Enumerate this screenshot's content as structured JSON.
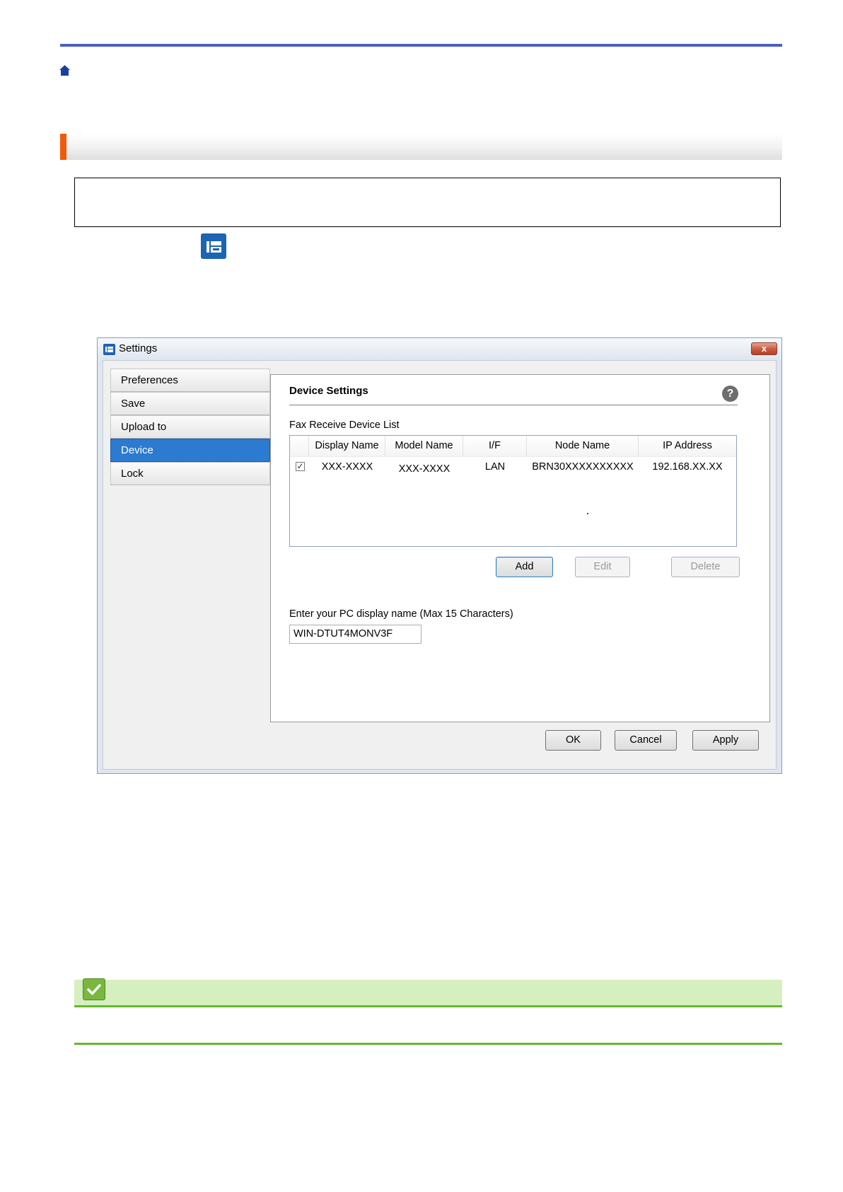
{
  "settings_window": {
    "title": "Settings",
    "close_label": "x",
    "sidebar": {
      "items": [
        {
          "label": "Preferences",
          "active": false
        },
        {
          "label": "Save",
          "active": false
        },
        {
          "label": "Upload to",
          "active": false
        },
        {
          "label": "Device",
          "active": true
        },
        {
          "label": "Lock",
          "active": false
        }
      ]
    },
    "panel": {
      "title": "Device Settings",
      "help_label": "?",
      "list_label": "Fax Receive Device List",
      "columns": [
        "Display Name",
        "Model Name",
        "I/F",
        "Node Name",
        "IP Address"
      ],
      "rows": [
        {
          "checked": true,
          "display_name": "XXX-XXXX",
          "model_name": "XXX-XXXX",
          "interface": "LAN",
          "node_name": "BRN30XXXXXXXXXX",
          "ip_address": "192.168.XX.XX"
        }
      ],
      "buttons": {
        "add": "Add",
        "edit": "Edit",
        "delete": "Delete"
      },
      "pc_name_label": "Enter your PC display name (Max 15 Characters)",
      "pc_name_value": "WIN-DTUT4MONV3F"
    },
    "footer_buttons": {
      "ok": "OK",
      "cancel": "Cancel",
      "apply": "Apply"
    }
  },
  "icons": {
    "home": "home-icon",
    "app": "brother-app-icon",
    "tip": "checkmark-icon"
  },
  "colors": {
    "top_rule": "#4a5fc1",
    "section_accent": "#f05a0a",
    "active_nav": "#2b7bd0",
    "tip_bar": "#d6efbf",
    "tip_rule": "#63b82f"
  }
}
